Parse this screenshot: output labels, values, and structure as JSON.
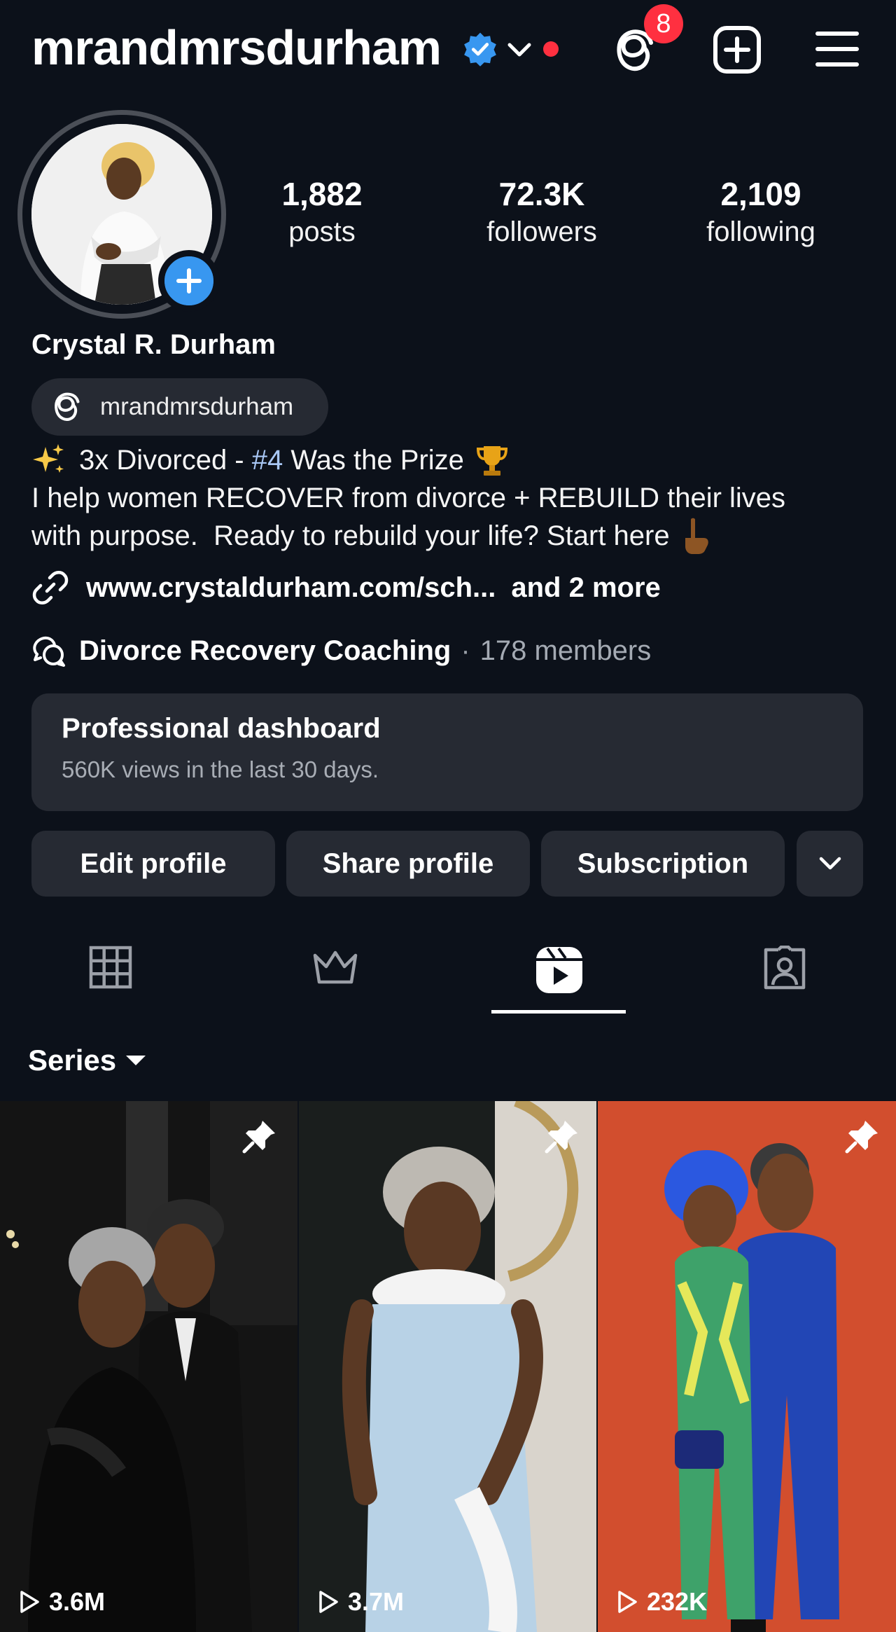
{
  "header": {
    "username": "mrandmrsdurham",
    "notification_count": "8",
    "verified_icon": "verified-badge-icon",
    "accent_color": "#3897f0",
    "badge_color": "#ff3040"
  },
  "profile": {
    "stats": [
      {
        "value": "1,882",
        "label": "posts"
      },
      {
        "value": "72.3K",
        "label": "followers"
      },
      {
        "value": "2,109",
        "label": "following"
      }
    ],
    "full_name": "Crystal R. Durham",
    "threads_handle": "mrandmrsdurham",
    "bio": {
      "line1_pre": "3x Divorced - ",
      "line1_hashtag": "#4",
      "line1_post": " Was the Prize",
      "line2": "I help women RECOVER from divorce + REBUILD their lives",
      "line3": "with purpose.  Ready to rebuild your life? Start here"
    },
    "link": {
      "url_text": "www.crystaldurham.com/sch...",
      "more_text": "and 2 more"
    },
    "channel": {
      "name": "Divorce Recovery Coaching",
      "separator": "·",
      "members": "178 members"
    }
  },
  "dashboard": {
    "title": "Professional dashboard",
    "subtitle": "560K views in the last 30 days."
  },
  "actions": {
    "edit": "Edit profile",
    "share": "Share profile",
    "subscription": "Subscription"
  },
  "tabs": {
    "items": [
      "grid-icon",
      "crown-icon",
      "reels-icon",
      "tagged-icon"
    ],
    "active": "reels"
  },
  "filter": {
    "label": "Series"
  },
  "grid": {
    "tiles": [
      {
        "views": "3.6M",
        "pinned": true
      },
      {
        "views": "3.7M",
        "pinned": true
      },
      {
        "views": "232K",
        "pinned": true
      }
    ]
  }
}
